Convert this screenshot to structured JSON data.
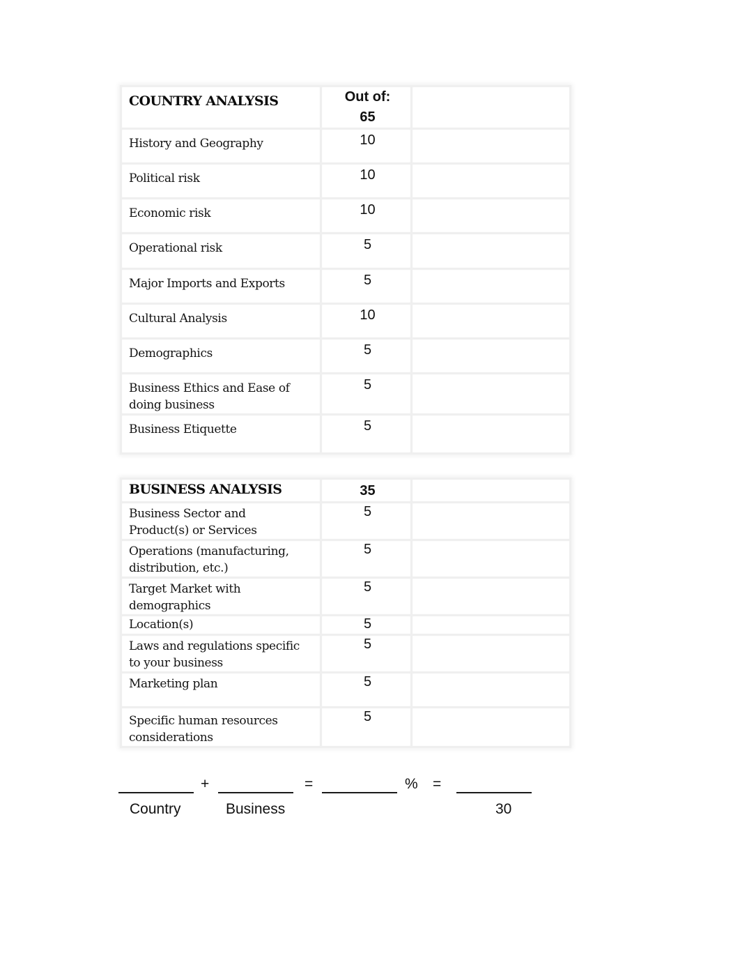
{
  "country_analysis": {
    "title": "COUNTRY ANALYSIS",
    "out_of_label": "Out of:",
    "total": "65",
    "items": [
      {
        "label": "History and Geography",
        "points": "10"
      },
      {
        "label": "Political risk",
        "points": "10"
      },
      {
        "label": "Economic risk",
        "points": "10"
      },
      {
        "label": "Operational risk",
        "points": "5"
      },
      {
        "label": "Major Imports and Exports",
        "points": "5"
      },
      {
        "label": "Cultural Analysis",
        "points": "10"
      },
      {
        "label": "Demographics",
        "points": "5"
      },
      {
        "label_line1": "Business Ethics and Ease of",
        "label_line2": "doing business",
        "points": "5"
      },
      {
        "label": "Business Etiquette",
        "points": "5"
      }
    ]
  },
  "business_analysis": {
    "title": "BUSINESS ANALYSIS",
    "total": "35",
    "items": [
      {
        "label_line1": "Business Sector and",
        "label_line2": "Product(s) or Services",
        "points": "5"
      },
      {
        "label_line1": "Operations (manufacturing,",
        "label_line2": "distribution, etc.)",
        "points": "5"
      },
      {
        "label_line1": "Target Market with",
        "label_line2": "demographics",
        "points": "5"
      },
      {
        "label": "Location(s)",
        "points": "5"
      },
      {
        "label_line1": "Laws and regulations specific",
        "label_line2": "to your business",
        "points": "5"
      },
      {
        "label": "Marketing plan",
        "points": "5"
      },
      {
        "label_line1": "Specific human resources",
        "label_line2": "considerations",
        "points": "5"
      }
    ]
  },
  "formula": {
    "plus": "+",
    "equals_1": "=",
    "percent": "%",
    "equals_2": "=",
    "caption_country": "Country",
    "caption_business": "Business",
    "caption_final": "30"
  }
}
